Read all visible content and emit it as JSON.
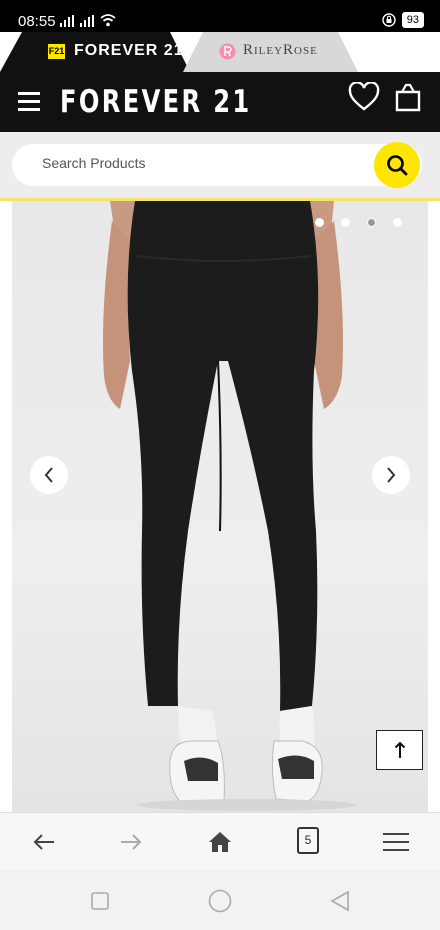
{
  "status_bar": {
    "time": "08:55",
    "battery": "93"
  },
  "brand_tabs": [
    {
      "label": "FOREVER 21",
      "badge": "F21",
      "active": true
    },
    {
      "label": "RileyRose",
      "active": false
    }
  ],
  "header": {
    "logo": "FOREVER 21",
    "icons": [
      "menu-icon",
      "heart-icon",
      "shopping-bag-icon"
    ]
  },
  "search": {
    "placeholder": "Search Products",
    "value": ""
  },
  "gallery": {
    "image_count": 4,
    "active_index": 2,
    "icons": [
      "chevron-left-icon",
      "chevron-right-icon",
      "arrow-up-icon"
    ]
  },
  "browser_toolbar": {
    "tab_count": "5",
    "icons": [
      "back-arrow-icon",
      "forward-arrow-icon",
      "home-icon",
      "tabs-icon",
      "menu-icon"
    ]
  },
  "colors": {
    "brand_yellow": "#ffe600",
    "header_black": "#111111",
    "riley_pink": "#f48fb1"
  }
}
